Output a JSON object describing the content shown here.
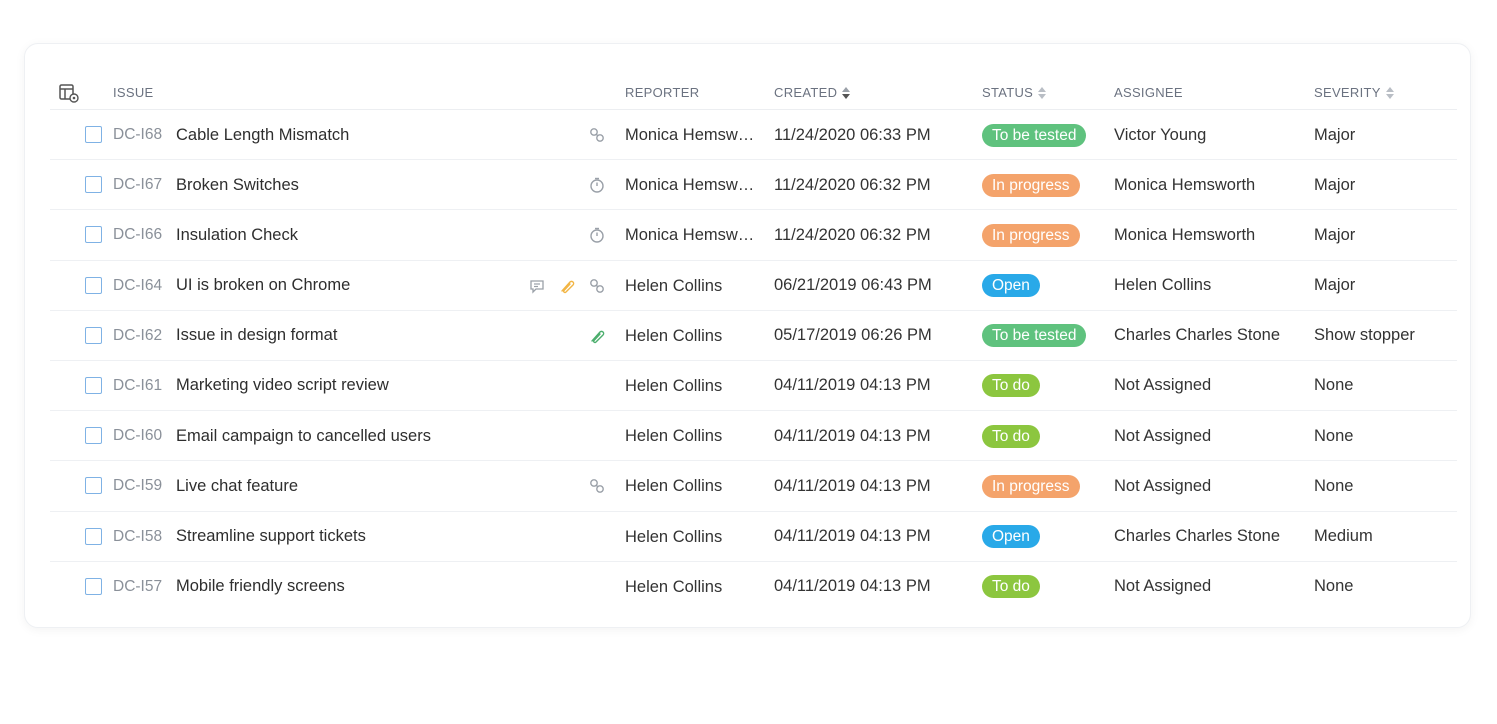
{
  "header": {
    "issue": "ISSUE",
    "reporter": "REPORTER",
    "created": "CREATED",
    "status": "STATUS",
    "assignee": "ASSIGNEE",
    "severity": "SEVERITY"
  },
  "colors": {
    "to_be_tested": "#5fc27e",
    "in_progress": "#f4a36b",
    "open": "#29a9e8",
    "to_do": "#8cc63f",
    "checkbox": "#7fb2e5"
  },
  "rows": [
    {
      "key": "DC-I68",
      "title": "Cable Length Mismatch",
      "icons": [
        "link-icon"
      ],
      "reporter": "Monica Hemsworth",
      "created": "11/24/2020 06:33 PM",
      "status": "To be tested",
      "status_color": "#5fc27e",
      "assignee": "Victor Young",
      "severity": "Major"
    },
    {
      "key": "DC-I67",
      "title": "Broken Switches",
      "icons": [
        "timer-icon"
      ],
      "reporter": "Monica Hemsworth",
      "created": "11/24/2020 06:32 PM",
      "status": "In progress",
      "status_color": "#f4a36b",
      "assignee": "Monica Hemsworth",
      "severity": "Major"
    },
    {
      "key": "DC-I66",
      "title": "Insulation Check",
      "icons": [
        "timer-icon"
      ],
      "reporter": "Monica Hemsworth",
      "created": "11/24/2020 06:32 PM",
      "status": "In progress",
      "status_color": "#f4a36b",
      "assignee": "Monica Hemsworth",
      "severity": "Major"
    },
    {
      "key": "DC-I64",
      "title": "UI is broken on Chrome",
      "icons": [
        "comment-icon",
        "attachment-icon-orange",
        "link-icon"
      ],
      "reporter": "Helen Collins",
      "created": "06/21/2019 06:43 PM",
      "status": "Open",
      "status_color": "#29a9e8",
      "assignee": "Helen Collins",
      "severity": "Major"
    },
    {
      "key": "DC-I62",
      "title": "Issue in design format",
      "icons": [
        "attachment-icon-green"
      ],
      "reporter": "Helen Collins",
      "created": "05/17/2019 06:26 PM",
      "status": "To be tested",
      "status_color": "#5fc27e",
      "assignee": "Charles Charles Stone",
      "severity": "Show stopper"
    },
    {
      "key": "DC-I61",
      "title": "Marketing video script review",
      "icons": [],
      "reporter": "Helen Collins",
      "created": "04/11/2019 04:13 PM",
      "status": "To do",
      "status_color": "#8cc63f",
      "assignee": "Not Assigned",
      "severity": "None"
    },
    {
      "key": "DC-I60",
      "title": "Email campaign to cancelled users",
      "icons": [],
      "reporter": "Helen Collins",
      "created": "04/11/2019 04:13 PM",
      "status": "To do",
      "status_color": "#8cc63f",
      "assignee": "Not Assigned",
      "severity": "None"
    },
    {
      "key": "DC-I59",
      "title": "Live chat feature",
      "icons": [
        "link-icon"
      ],
      "reporter": "Helen Collins",
      "created": "04/11/2019 04:13 PM",
      "status": "In progress",
      "status_color": "#f4a36b",
      "assignee": "Not Assigned",
      "severity": "None"
    },
    {
      "key": "DC-I58",
      "title": "Streamline support tickets",
      "icons": [],
      "reporter": "Helen Collins",
      "created": "04/11/2019 04:13 PM",
      "status": "Open",
      "status_color": "#29a9e8",
      "assignee": "Charles Charles Stone",
      "severity": "Medium"
    },
    {
      "key": "DC-I57",
      "title": "Mobile friendly screens",
      "icons": [],
      "reporter": "Helen Collins",
      "created": "04/11/2019 04:13 PM",
      "status": "To do",
      "status_color": "#8cc63f",
      "assignee": "Not Assigned",
      "severity": "None"
    }
  ]
}
